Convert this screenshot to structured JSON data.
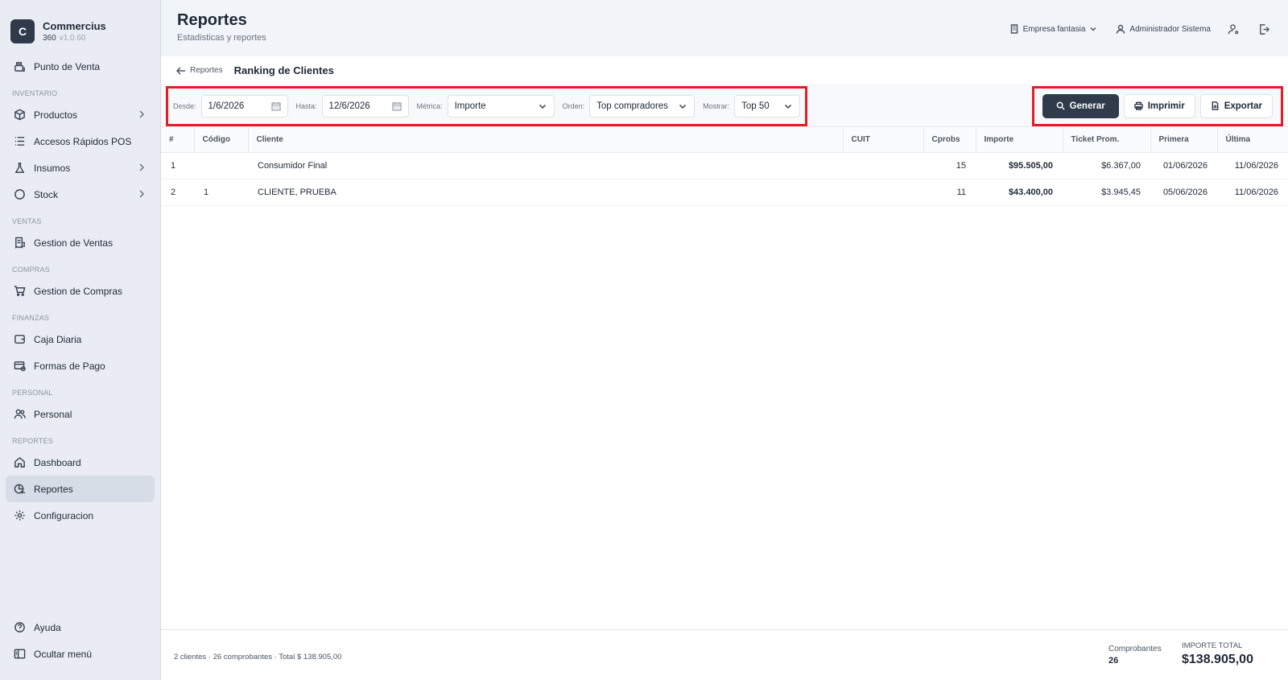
{
  "brand": {
    "initial": "C",
    "name": "Commercius",
    "sub": "360",
    "version": "v1.0.60"
  },
  "sidebar": {
    "top_items": [
      {
        "label": "Punto de Venta"
      }
    ],
    "sections": [
      {
        "title": "INVENTARIO",
        "items": [
          {
            "label": "Productos"
          },
          {
            "label": "Accesos Rápidos POS"
          },
          {
            "label": "Insumos"
          },
          {
            "label": "Stock"
          }
        ]
      },
      {
        "title": "VENTAS",
        "items": [
          {
            "label": "Gestion de Ventas"
          }
        ]
      },
      {
        "title": "COMPRAS",
        "items": [
          {
            "label": "Gestion de Compras"
          }
        ]
      },
      {
        "title": "FINANZAS",
        "items": [
          {
            "label": "Caja Diaria"
          },
          {
            "label": "Formas de Pago"
          }
        ]
      },
      {
        "title": "PERSONAL",
        "items": [
          {
            "label": "Personal"
          }
        ]
      },
      {
        "title": "REPORTES",
        "items": [
          {
            "label": "Dashboard"
          },
          {
            "label": "Reportes"
          },
          {
            "label": "Configuracion"
          }
        ]
      }
    ],
    "bottom_items": [
      {
        "label": "Ayuda"
      },
      {
        "label": "Ocultar menú"
      }
    ]
  },
  "header": {
    "title": "Reportes",
    "subtitle": "Estadisticas y reportes",
    "company": "Empresa fantasia",
    "user": "Administrador Sistema"
  },
  "breadcrumb": {
    "back_label": "Reportes",
    "title": "Ranking de Clientes"
  },
  "filters": {
    "desde_label": "Desde:",
    "desde_value": "1/6/2026",
    "hasta_label": "Hasta:",
    "hasta_value": "12/6/2026",
    "metrica_label": "Métrica:",
    "metrica_value": "Importe",
    "orden_label": "Orden:",
    "orden_value": "Top compradores",
    "mostrar_label": "Mostrar:",
    "mostrar_value": "Top 50"
  },
  "actions": {
    "generar": "Generar",
    "imprimir": "Imprimir",
    "exportar": "Exportar"
  },
  "table": {
    "headers": {
      "rank": "#",
      "codigo": "Código",
      "cliente": "Cliente",
      "cuit": "CUIT",
      "cprobs": "Cprobs",
      "importe": "Importe",
      "ticket": "Ticket Prom.",
      "primera": "Primera",
      "ultima": "Última"
    },
    "rows": [
      {
        "rank": "1",
        "codigo": "",
        "cliente": "Consumidor Final",
        "cuit": "",
        "cprobs": "15",
        "importe": "$95.505,00",
        "ticket": "$6.367,00",
        "primera": "01/06/2026",
        "ultima": "11/06/2026"
      },
      {
        "rank": "2",
        "codigo": "1",
        "cliente": "CLIENTE, PRUEBA",
        "cuit": "",
        "cprobs": "11",
        "importe": "$43.400,00",
        "ticket": "$3.945,45",
        "primera": "05/06/2026",
        "ultima": "11/06/2026"
      }
    ]
  },
  "footer": {
    "summary": "2 clientes · 26 comprobantes · Total $ 138.905,00",
    "comprobantes_label": "Comprobantes",
    "comprobantes_value": "26",
    "importe_label": "IMPORTE TOTAL",
    "importe_value": "$138.905,00"
  }
}
